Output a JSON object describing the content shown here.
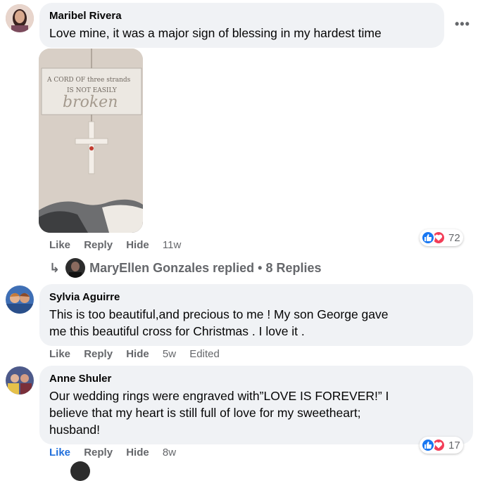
{
  "comments": [
    {
      "author": "Maribel Rivera",
      "text": "Love mine, it was a major sign of blessing in my hardest time",
      "actions": {
        "like": "Like",
        "reply": "Reply",
        "hide": "Hide",
        "time": "11w"
      },
      "reactions": {
        "icons": [
          "like-icon",
          "love-icon"
        ],
        "count": "72"
      },
      "photo": {
        "sign_line1": "A CORD OF three strands",
        "sign_line2": "IS NOT EASILY",
        "sign_line3": "broken"
      },
      "replies_summary": {
        "name": "MaryEllen Gonzales",
        "text": "replied • 8 Replies"
      }
    },
    {
      "author": "Sylvia Aguirre",
      "text_line1": "This is too beautiful,and precious to me ! My son George gave",
      "text_line2": "me this beautiful cross for Christmas . I love it .",
      "actions": {
        "like": "Like",
        "reply": "Reply",
        "hide": "Hide",
        "time": "5w",
        "edited": "Edited"
      }
    },
    {
      "author": "Anne Shuler",
      "text_line1": "Our wedding rings were engraved with”LOVE IS FOREVER!” I",
      "text_line2": "believe that my heart is still full of love for my sweetheart;",
      "text_line3": "husband!",
      "actions": {
        "like": "Like",
        "reply": "Reply",
        "hide": "Hide",
        "time": "8w"
      },
      "reactions": {
        "icons": [
          "like-icon",
          "love-icon"
        ],
        "count": "17"
      }
    }
  ],
  "colors": {
    "bubble": "#f0f2f5",
    "secondary_text": "#65676b",
    "like_active": "#216fdb",
    "like_blue": "#1877f2",
    "love_red": "#f33e58"
  }
}
